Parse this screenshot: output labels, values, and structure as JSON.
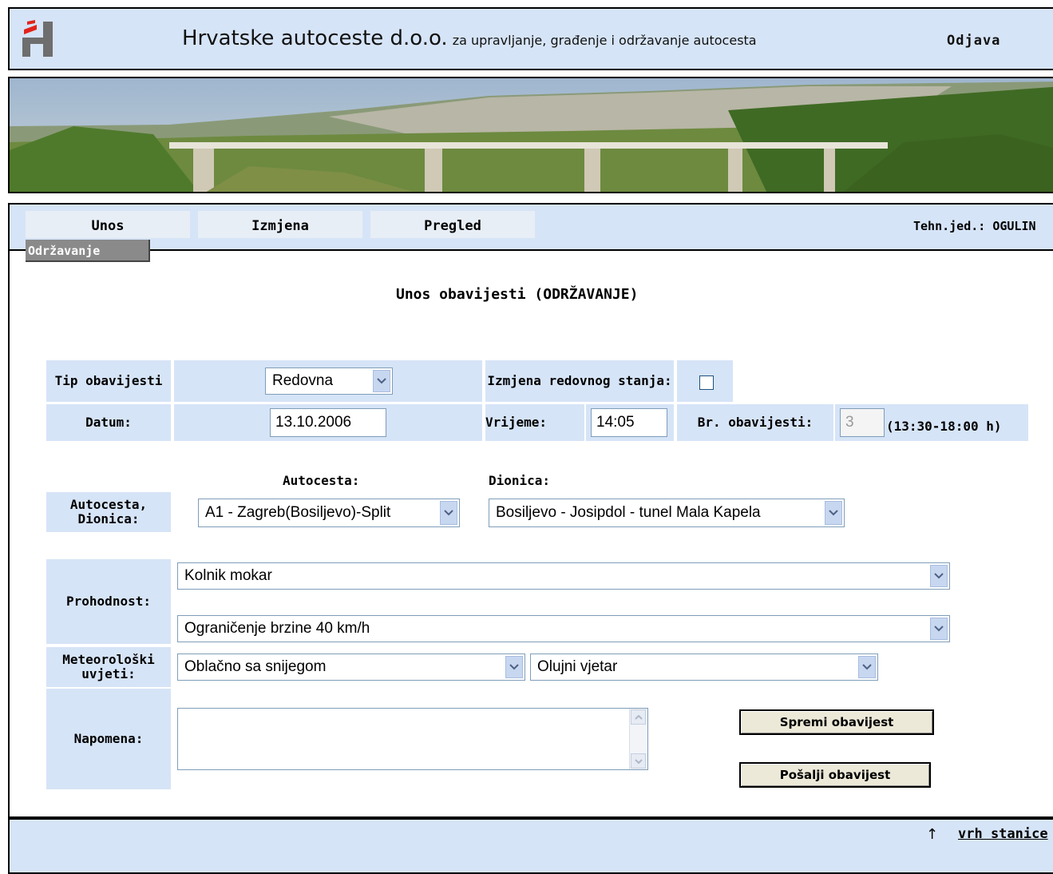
{
  "header": {
    "org_name": "Hrvatske autoceste d.o.o.",
    "org_subtitle": "za upravljanje, građenje i održavanje autocesta",
    "logout_label": "Odjava",
    "logo_icon": "hac-logo-icon"
  },
  "nav": {
    "tabs": [
      {
        "label": "Unos"
      },
      {
        "label": "Izmjena"
      },
      {
        "label": "Pregled"
      }
    ],
    "tech_unit": "Tehn.jed.: OGULIN",
    "subtab": "Održavanje"
  },
  "main": {
    "title": "Unos obavijesti (ODRŽAVANJE)",
    "tip_label": "Tip obavijesti",
    "tip_value": "Redovna",
    "izmjena_label": "Izmjena redovnog stanja:",
    "datum_label": "Datum:",
    "datum_value": "13.10.2006",
    "vrijeme_label": "Vrijeme:",
    "vrijeme_value": "14:05",
    "br_label": "Br. obavijesti:",
    "br_value": "3",
    "br_range": "(13:30-18:00 h)",
    "autocesta_head": "Autocesta:",
    "dionica_head": "Dionica:",
    "autocesta_dionica_label": "Autocesta, Dionica:",
    "autocesta_value": "A1 - Zagreb(Bosiljevo)-Split",
    "dionica_value": "Bosiljevo - Josipdol - tunel Mala Kapela",
    "prohodnost_label": "Prohodnost:",
    "prohodnost_1": "Kolnik mokar",
    "prohodnost_2": "Ograničenje brzine 40 km/h",
    "meteo_label": "Meteorološki uvjeti:",
    "meteo_1": "Oblačno sa snijegom",
    "meteo_2": "Olujni vjetar",
    "napomena_label": "Napomena:",
    "napomena_value": "",
    "spremi_label": "Spremi obavijest",
    "posalji_label": "Pošalji obavijest"
  },
  "footer": {
    "top_arrow": "↑",
    "top_link": "vrh stanice"
  },
  "colors": {
    "panel_blue": "#d6e4f7",
    "tab_gray": "#e8eef6",
    "subtab_gray": "#8a8a8a",
    "logo_red": "#e2231a",
    "logo_gray": "#6e6e6e"
  }
}
